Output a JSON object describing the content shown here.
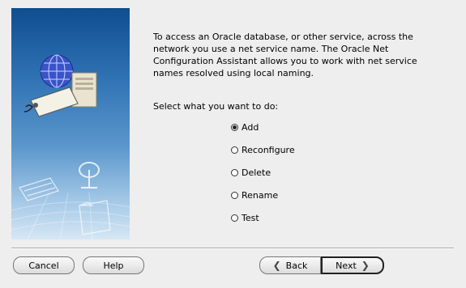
{
  "intro_text": "To access an Oracle database, or other service, across the network you use a net service name. The Oracle Net Configuration Assistant allows you to work with net service names resolved using local naming.",
  "prompt": "Select what you want to do:",
  "options": [
    {
      "label": "Add",
      "checked": true
    },
    {
      "label": "Reconfigure",
      "checked": false
    },
    {
      "label": "Delete",
      "checked": false
    },
    {
      "label": "Rename",
      "checked": false
    },
    {
      "label": "Test",
      "checked": false
    }
  ],
  "buttons": {
    "cancel": "Cancel",
    "help": "Help",
    "back": "Back",
    "next": "Next"
  },
  "icons": {
    "back": "chevron-left-icon",
    "next": "chevron-right-icon"
  }
}
